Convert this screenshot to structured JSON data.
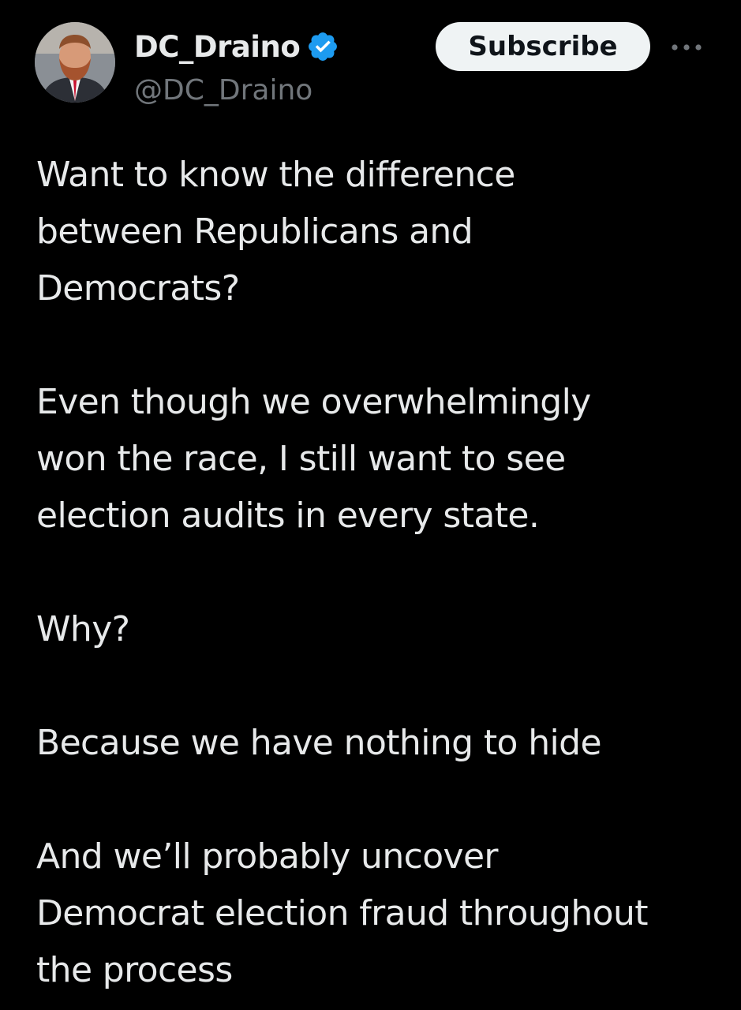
{
  "author": {
    "display_name": "DC_Draino",
    "handle": "@DC_Draino",
    "verified": true,
    "verified_color": "#1d9bf0"
  },
  "actions": {
    "subscribe_label": "Subscribe",
    "more_icon": "ellipsis-icon"
  },
  "tweet": {
    "paragraphs": [
      {
        "lines": [
          "Want to know the difference",
          "between Republicans and",
          "Democrats?"
        ]
      },
      {
        "lines": [
          "Even though we overwhelmingly",
          "won the race, I still want to see",
          "election audits in every state."
        ]
      },
      {
        "lines": [
          "Why?"
        ]
      },
      {
        "lines": [
          "Because we have nothing to hide"
        ]
      },
      {
        "lines": [
          "And we’ll probably uncover",
          "Democrat election fraud throughout",
          "the process"
        ]
      }
    ]
  },
  "colors": {
    "background": "#000000",
    "text": "#e7e9ea",
    "secondary_text": "#71767b",
    "button_bg": "#eff3f4",
    "button_text": "#0f1419"
  }
}
